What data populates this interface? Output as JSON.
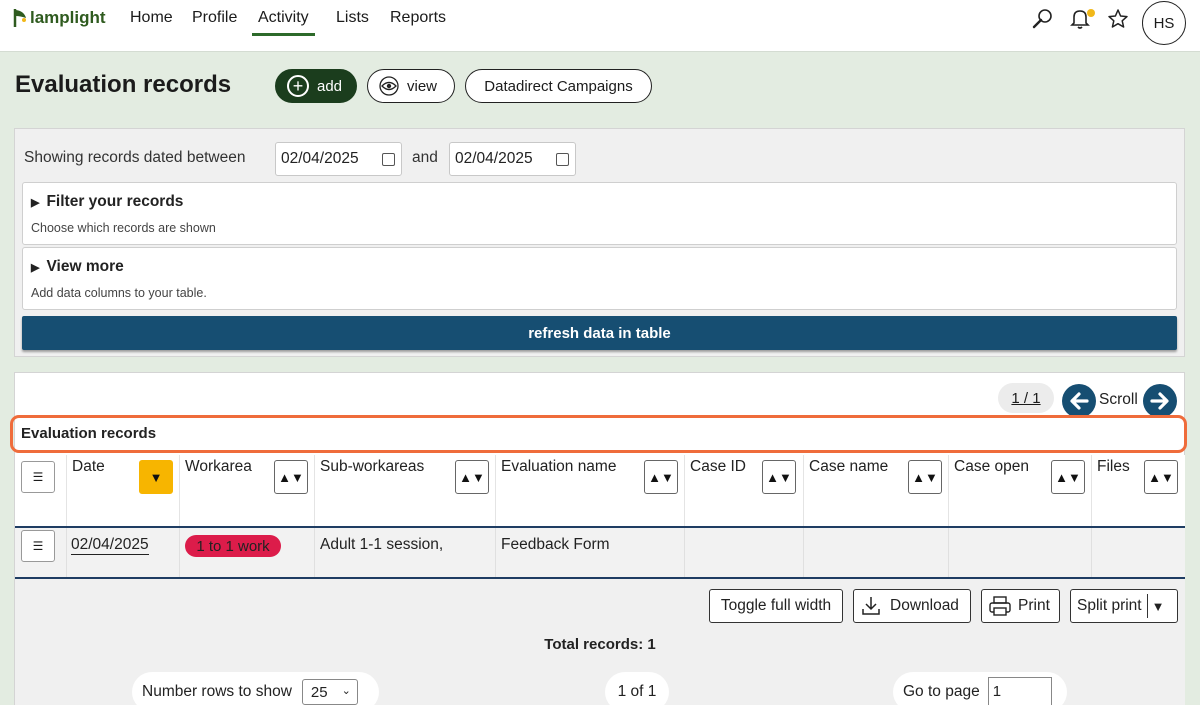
{
  "nav": {
    "logo_text": "lamplight",
    "items": [
      {
        "label": "Home"
      },
      {
        "label": "Profile"
      },
      {
        "label": "Activity"
      },
      {
        "label": "Lists"
      },
      {
        "label": "Reports"
      }
    ],
    "active": "Activity",
    "avatar_initials": "HS",
    "icons": [
      "search-icon",
      "bell-icon",
      "star-icon"
    ]
  },
  "header": {
    "title": "Evaluation records",
    "add_label": "add",
    "view_label": "view",
    "campaigns_label": "Datadirect Campaigns"
  },
  "filter": {
    "showing_label": "Showing records dated between",
    "date_from": "02/04/2025",
    "and_label": "and",
    "date_to": "02/04/2025",
    "filter_title": "Filter your records",
    "filter_sub": "Choose which records are shown",
    "viewmore_title": "View more",
    "viewmore_sub": "Add data columns to your table.",
    "refresh_label": "refresh data in table"
  },
  "table": {
    "page_indicator": "1 / 1",
    "scroll_label": "Scroll",
    "section_label": "Evaluation records",
    "columns": [
      {
        "label": "Date"
      },
      {
        "label": "Workarea"
      },
      {
        "label": "Sub-workareas"
      },
      {
        "label": "Evaluation name"
      },
      {
        "label": "Case ID"
      },
      {
        "label": "Case name"
      },
      {
        "label": "Case open"
      },
      {
        "label": "Files"
      }
    ],
    "rows": [
      {
        "date": "02/04/2025",
        "workarea": "1 to 1 work",
        "sub_workareas": "Adult 1-1 session,",
        "evaluation_name": "Feedback Form",
        "case_id": "",
        "case_name": "",
        "case_open": "",
        "files": ""
      }
    ]
  },
  "footer": {
    "toggle_label": "Toggle full width",
    "download_label": "Download",
    "print_label": "Print",
    "split_print_label": "Split print",
    "total_label": "Total records: 1",
    "rows_label": "Number rows to show",
    "rows_value": "25",
    "page_of": "1 of 1",
    "goto_label": "Go to page",
    "goto_value": "1"
  },
  "colors": {
    "brand_green": "#1b3d1d",
    "navy": "#164e72",
    "badge_red": "#dc1c4a",
    "sort_active": "#f7b500",
    "highlight": "#ef6c3b"
  }
}
